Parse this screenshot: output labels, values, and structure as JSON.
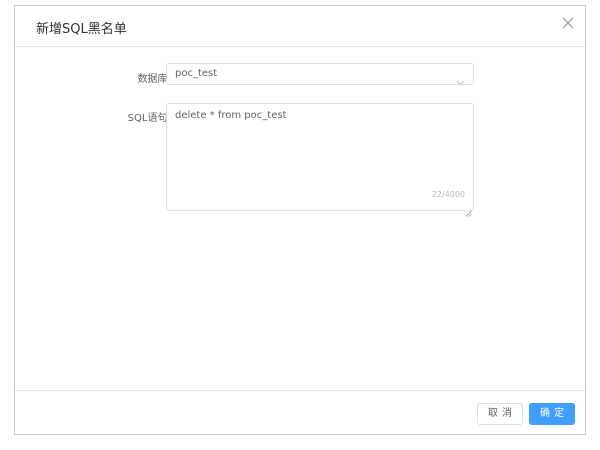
{
  "dialog": {
    "title": "新增SQL黑名单",
    "close_icon": "close-icon"
  },
  "form": {
    "database": {
      "label": "数据库 :",
      "value": "poc_test",
      "arrow_icon": "chevron-down-icon"
    },
    "sql": {
      "label": "SQL语句 :",
      "value": "delete * from poc_test",
      "word_count": "22/4000"
    }
  },
  "footer": {
    "cancel_label": "取消",
    "confirm_label": "确定"
  },
  "colors": {
    "primary": "#409eff",
    "border": "#dcdfe6",
    "text": "#606266"
  }
}
